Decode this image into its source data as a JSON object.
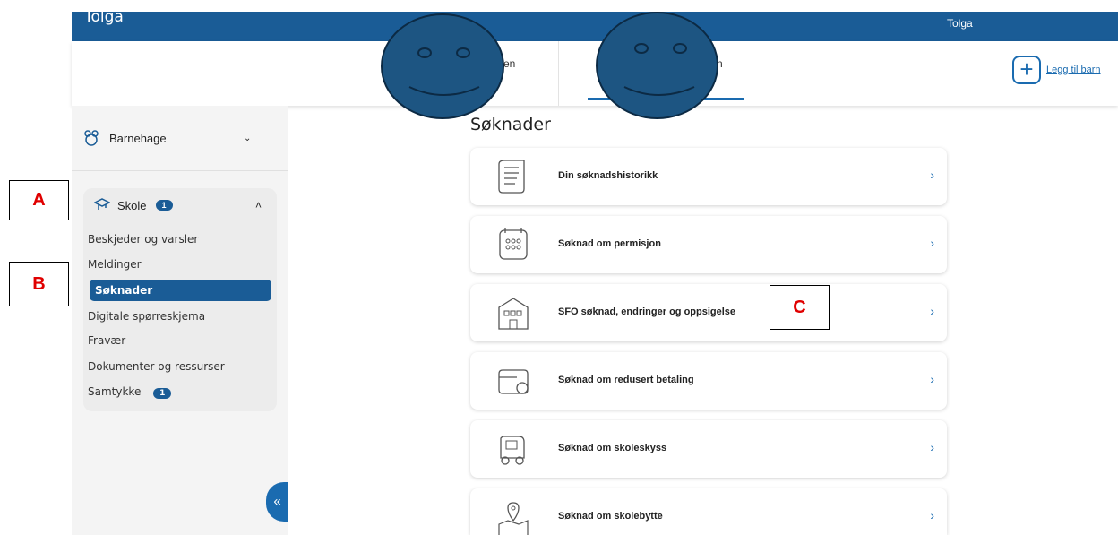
{
  "header": {
    "title": "Tolga",
    "user_name": "Tolga",
    "menu_icon": "chevron-down-icon"
  },
  "children_tabs": [
    {
      "label": "en"
    },
    {
      "label": "n"
    }
  ],
  "add_child": {
    "label": "Legg til barn",
    "icon": "plus-icon"
  },
  "sidebar": {
    "barnehage": {
      "label": "Barnehage",
      "icon": "teddy-icon"
    },
    "skole": {
      "label": "Skole",
      "badge": "1",
      "icon": "graduation-cap-icon",
      "items": [
        {
          "label": "Beskjeder og varsler"
        },
        {
          "label": "Meldinger"
        },
        {
          "label": "Søknader",
          "active": true
        },
        {
          "label": "Digitale spørreskjema"
        },
        {
          "label": "Fravær"
        },
        {
          "label": "Dokumenter og ressurser"
        },
        {
          "label": "Samtykke",
          "badge": "1"
        }
      ]
    },
    "collapse_icon": "«"
  },
  "main": {
    "title": "Søknader",
    "cards": [
      {
        "label": "Din søknadshistorikk",
        "icon": "scroll-icon"
      },
      {
        "label": "Søknad om permisjon",
        "icon": "calendar-icon"
      },
      {
        "label": "SFO søknad, endringer og oppsigelse",
        "icon": "building-icon"
      },
      {
        "label": "Søknad om redusert betaling",
        "icon": "wallet-icon"
      },
      {
        "label": "Søknad om skoleskyss",
        "icon": "car-icon"
      },
      {
        "label": "Søknad om skolebytte",
        "icon": "map-pin-icon"
      }
    ]
  },
  "annotations": {
    "a": "A",
    "b": "B",
    "c": "C"
  },
  "colors": {
    "primary": "#1a5c96",
    "accent": "#1a6bb0",
    "annotation_text": "#e00000"
  }
}
